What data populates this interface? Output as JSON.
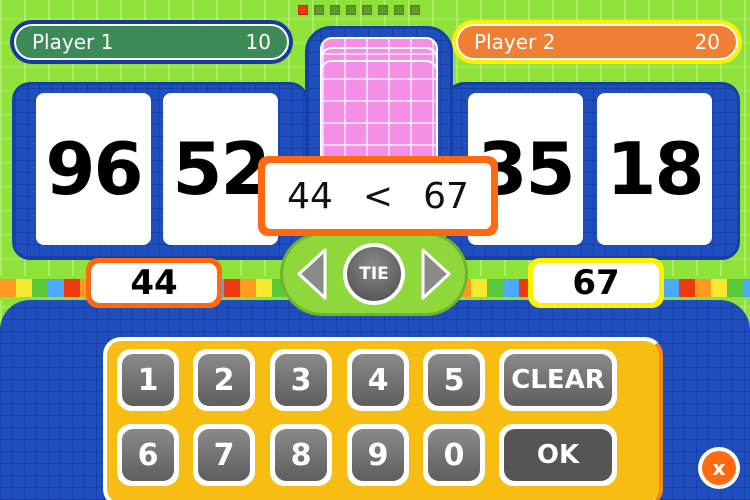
{
  "progress": {
    "total_rounds": 8,
    "current_round": 1,
    "active_color": "#ee3a10",
    "inactive_color": "#5f9a2a"
  },
  "players": [
    {
      "name": "Player 1",
      "score": "10",
      "color": "#3b8a58"
    },
    {
      "name": "Player 2",
      "score": "20",
      "color": "#ef7f33"
    }
  ],
  "cards": {
    "player1": [
      "96",
      "52"
    ],
    "player2": [
      "35",
      "18"
    ]
  },
  "comparison": {
    "left": "44",
    "operator": "<",
    "right": "67"
  },
  "answers": {
    "player1": "44",
    "player2": "67"
  },
  "controls": {
    "left_arrow": "left-arrow-icon",
    "tie_label": "TIE",
    "right_arrow": "right-arrow-icon"
  },
  "keypad": {
    "row1": [
      "1",
      "2",
      "3",
      "4",
      "5"
    ],
    "row2": [
      "6",
      "7",
      "8",
      "9",
      "0"
    ],
    "clear_label": "CLEAR",
    "ok_label": "OK"
  },
  "close": {
    "label": "x"
  }
}
